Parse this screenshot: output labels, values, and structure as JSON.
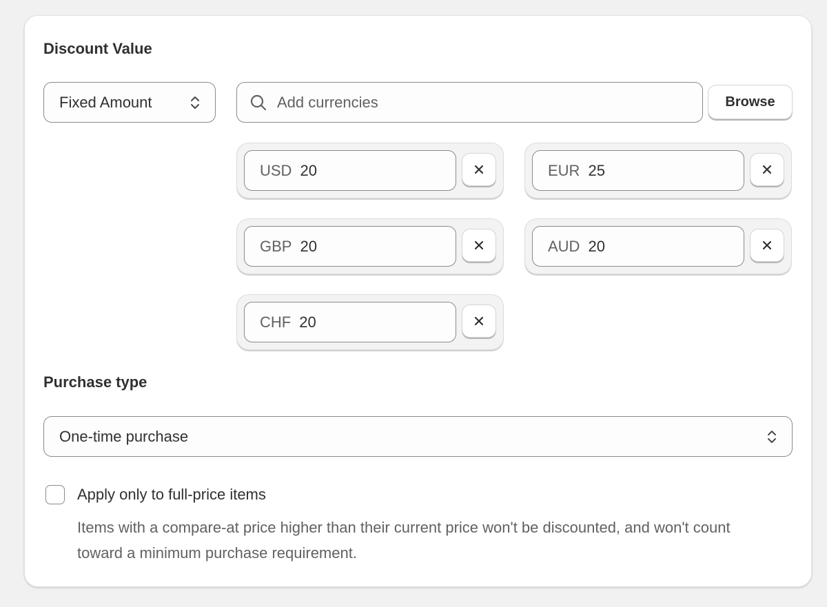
{
  "discount_value": {
    "title": "Discount Value",
    "type_select": {
      "value": "Fixed Amount"
    },
    "search": {
      "placeholder": "Add currencies"
    },
    "browse_label": "Browse",
    "currencies": [
      {
        "code": "USD",
        "amount": "20"
      },
      {
        "code": "EUR",
        "amount": "25"
      },
      {
        "code": "GBP",
        "amount": "20"
      },
      {
        "code": "AUD",
        "amount": "20"
      },
      {
        "code": "CHF",
        "amount": "20"
      }
    ]
  },
  "purchase_type": {
    "title": "Purchase type",
    "select": {
      "value": "One-time purchase"
    }
  },
  "full_price": {
    "checked": false,
    "label": "Apply only to full-price items",
    "help": "Items with a compare-at price higher than their current price won't be discounted, and won't count toward a minimum purchase requirement."
  },
  "icons": {
    "search": "search-icon",
    "chevron": "chevron-up-down-icon",
    "remove": "close-icon"
  }
}
